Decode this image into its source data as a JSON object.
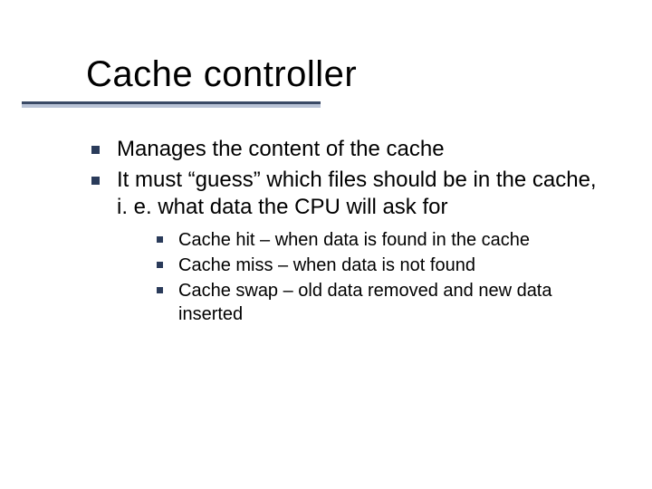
{
  "title": "Cache controller",
  "bullets": [
    {
      "text": "Manages the content of the cache"
    },
    {
      "text": "It must “guess” which files should be in the cache, i. e. what data the CPU will ask for",
      "sub": [
        {
          "text": "Cache hit – when data is found in the cache"
        },
        {
          "text": "Cache miss – when data is not found"
        },
        {
          "text": "Cache swap – old data removed and new data inserted"
        }
      ]
    }
  ]
}
